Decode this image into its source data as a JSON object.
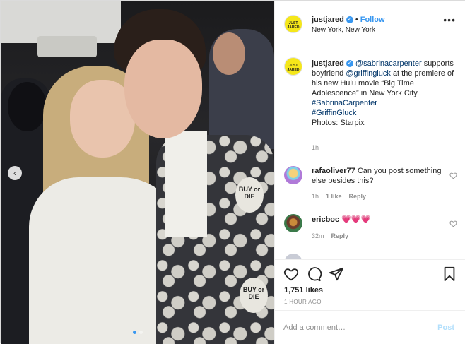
{
  "account": {
    "username": "justjared",
    "avatar_text": "JUST JARED",
    "follow_label": "Follow",
    "separator": "•",
    "location": "New York, New York"
  },
  "caption": {
    "username": "justjared",
    "mention1": "@sabrinacarpenter",
    "text1": "supports boyfriend",
    "mention2": "@griffingluck",
    "text2": "at the premiere of his new Hulu movie “Big Time Adolescence” in New York City.",
    "hashtag1": "#SabrinaCarpenter",
    "hashtag2": "#GriffinGluck",
    "credit": "Photos: Starpix",
    "time": "1h"
  },
  "comments": [
    {
      "username": "rafaoliver77",
      "text": "Can you post something else besides this?",
      "time": "1h",
      "likes": "1 like",
      "reply": "Reply"
    },
    {
      "username": "ericboc",
      "text": "💗💗💗",
      "time": "32m",
      "reply": "Reply"
    }
  ],
  "photo": {
    "patch_text_1": "BUY or DIE",
    "patch_text_2": "BUY or DIE"
  },
  "stats": {
    "likes": "1,751 likes",
    "time_ago": "1 HOUR AGO"
  },
  "composer": {
    "placeholder": "Add a comment…",
    "post_label": "Post"
  },
  "colors": {
    "accent": "#3897f0",
    "avatar_yellow": "#f5e71a"
  }
}
